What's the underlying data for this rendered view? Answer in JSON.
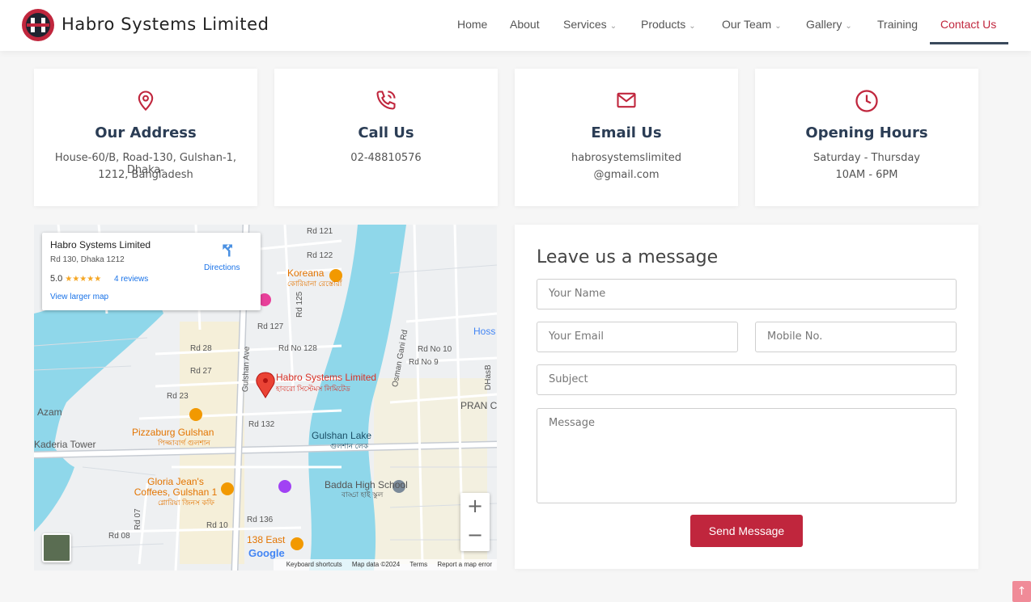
{
  "brand": {
    "name": "Habro Systems Limited",
    "logo_icon": "habro-h-logo"
  },
  "nav": {
    "items": [
      {
        "label": "Home",
        "dropdown": false
      },
      {
        "label": "About",
        "dropdown": false
      },
      {
        "label": "Services",
        "dropdown": true
      },
      {
        "label": "Products",
        "dropdown": true
      },
      {
        "label": "Our Team",
        "dropdown": true
      },
      {
        "label": "Gallery",
        "dropdown": true
      },
      {
        "label": "Training",
        "dropdown": false
      },
      {
        "label": "Contact Us",
        "dropdown": false,
        "active": true
      }
    ],
    "chevron_glyph": "﹀"
  },
  "cards": [
    {
      "icon": "map-pin-icon",
      "title": "Our Address",
      "lines": [
        "House-60/B, Road-130, Gulshan-1, Dhaka-",
        "1212, Bangladesh"
      ]
    },
    {
      "icon": "phone-icon",
      "title": "Call Us",
      "lines": [
        "02-48810576"
      ]
    },
    {
      "icon": "envelope-icon",
      "title": "Email Us",
      "lines": [
        "habrosystemslimited",
        "@gmail.com"
      ]
    },
    {
      "icon": "clock-icon",
      "title": "Opening Hours",
      "lines": [
        "Saturday - Thursday",
        "10AM - 6PM"
      ]
    }
  ],
  "map": {
    "place_name": "Habro Systems Limited",
    "place_address": "Rd 130, Dhaka 1212",
    "rating": "5.0",
    "stars": "★★★★★",
    "reviews": "4 reviews",
    "directions": "Directions",
    "larger_map": "View larger map",
    "zoom_in": "+",
    "zoom_out": "−",
    "footer": [
      "Keyboard shortcuts",
      "Map data ©2024",
      "Terms",
      "Report a map error"
    ],
    "logo": "Google",
    "labels": [
      "Rd 121",
      "Rd 122",
      "Rd 127",
      "Rd 28",
      "Rd 27",
      "Rd 23",
      "Rd No 128",
      "Rd No 10",
      "Rd No 9",
      "Rd 132",
      "Rd 136",
      "Rd 10",
      "Rd 08",
      "Rd 07",
      "Rd 125",
      "Gulshan Ave",
      "Osman Gani Rd",
      "DHasB",
      "PRAN C",
      "Hoss",
      "Azam",
      "Kaderia Tower"
    ],
    "pois": [
      {
        "name": "Koreana",
        "sub": "কোরিয়ানা রেস্তোরাঁ",
        "color": "#e37400"
      },
      {
        "name": "Habro Systems Limited",
        "sub": "হাবরো সিস্টেমস লিমিটেড",
        "color": "#d93025"
      },
      {
        "name": "Pizzaburg Gulshan",
        "sub": "পিজ্জাবার্গ গুলশান",
        "color": "#e37400"
      },
      {
        "name": "Gulshan Lake",
        "sub": "গুলশান লেক",
        "color": "#1a4e66"
      },
      {
        "name": "Gloria Jean's Coffees, Gulshan 1",
        "sub": "গ্লোরিয়া জিনস কফি",
        "color": "#e37400"
      },
      {
        "name": "Badda High School",
        "sub": "বাড্ডা হাই স্কুল",
        "color": "#555555"
      },
      {
        "name": "138 East",
        "sub": "",
        "color": "#e37400"
      }
    ],
    "water_color": "#8fd7ea",
    "block_color": "#f5efd9"
  },
  "form": {
    "title": "Leave us a message",
    "name_placeholder": "Your Name",
    "email_placeholder": "Your Email",
    "mobile_placeholder": "Mobile No.",
    "subject_placeholder": "Subject",
    "message_placeholder": "Message",
    "submit": "Send Message"
  },
  "colors": {
    "accent": "#c0263d",
    "heading": "#2b3d55",
    "nav_underline": "#3a4a5c"
  },
  "scroll_top_icon": "arrow-up-icon"
}
